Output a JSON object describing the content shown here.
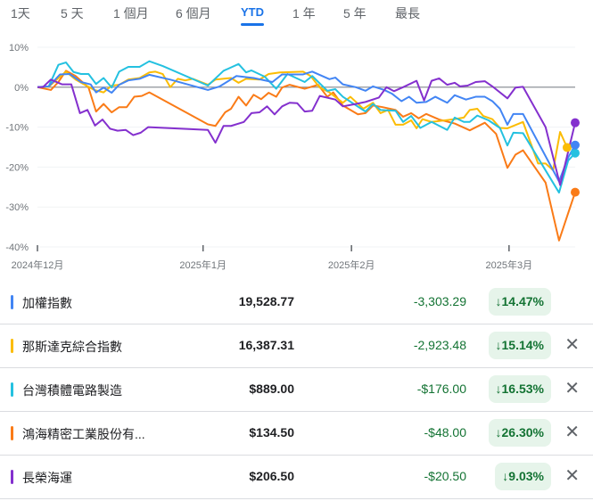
{
  "tabs": [
    {
      "label": "1天",
      "active": false
    },
    {
      "label": "5 天",
      "active": false
    },
    {
      "label": "1 個月",
      "active": false
    },
    {
      "label": "6 個月",
      "active": false
    },
    {
      "label": "YTD",
      "active": true
    },
    {
      "label": "1 年",
      "active": false
    },
    {
      "label": "5 年",
      "active": false
    },
    {
      "label": "最長",
      "active": false
    }
  ],
  "chart_data": {
    "type": "line",
    "title": "",
    "xlabel": "",
    "ylabel": "",
    "ylim": [
      -40,
      10
    ],
    "xlim": [
      0,
      100
    ],
    "yticks": [
      {
        "v": 10,
        "label": "10%"
      },
      {
        "v": 0,
        "label": "0%"
      },
      {
        "v": -10,
        "label": "-10%"
      },
      {
        "v": -20,
        "label": "-20%"
      },
      {
        "v": -30,
        "label": "-30%"
      },
      {
        "v": -40,
        "label": "-40%"
      }
    ],
    "xticks": [
      {
        "v": 0,
        "label": "2024年12月"
      },
      {
        "v": 30.8,
        "label": "2025年1月"
      },
      {
        "v": 58.4,
        "label": "2025年2月"
      },
      {
        "v": 87.7,
        "label": "2025年3月"
      }
    ],
    "series": [
      {
        "name": "加權指數",
        "color": "#4285f4",
        "points": [
          [
            0,
            0
          ],
          [
            2.1,
            0.2
          ],
          [
            4.2,
            3.2
          ],
          [
            6,
            3.3
          ],
          [
            8.1,
            1.3
          ],
          [
            9.9,
            0.7
          ],
          [
            10.9,
            -1.3
          ],
          [
            12.3,
            -0.1
          ],
          [
            13.8,
            -1.4
          ],
          [
            15.2,
            0.6
          ],
          [
            16.9,
            1.7
          ],
          [
            19,
            2.1
          ],
          [
            20.8,
            3.1
          ],
          [
            24.7,
            1.9
          ],
          [
            31.7,
            -0.7
          ],
          [
            33.9,
            0.2
          ],
          [
            37,
            2.8
          ],
          [
            40.2,
            2.3
          ],
          [
            43.7,
            1.3
          ],
          [
            45.5,
            3.2
          ],
          [
            49.4,
            3.2
          ],
          [
            51.1,
            3.9
          ],
          [
            54.3,
            2
          ],
          [
            55.4,
            2.4
          ],
          [
            56.8,
            0.7
          ],
          [
            59.2,
            0
          ],
          [
            61,
            -0.9
          ],
          [
            62.4,
            0.2
          ],
          [
            64.5,
            -0.7
          ],
          [
            65.9,
            -1.6
          ],
          [
            67.7,
            -3.5
          ],
          [
            69.1,
            -2.4
          ],
          [
            70.5,
            -3.9
          ],
          [
            72.3,
            -3.7
          ],
          [
            74,
            -2.4
          ],
          [
            76.2,
            -3.9
          ],
          [
            77.6,
            -2
          ],
          [
            79.7,
            -3.1
          ],
          [
            81.5,
            -2.4
          ],
          [
            83.2,
            -2.4
          ],
          [
            84.6,
            -3.5
          ],
          [
            86,
            -5.4
          ],
          [
            87.4,
            -9.4
          ],
          [
            88.5,
            -6.7
          ],
          [
            90.3,
            -6.7
          ],
          [
            97,
            -23.6
          ],
          [
            98.7,
            -17.6
          ],
          [
            100,
            -14.5
          ]
        ]
      },
      {
        "name": "那斯達克綜合指數",
        "color": "#fbbc04",
        "points": [
          [
            0,
            0
          ],
          [
            2.1,
            0.1
          ],
          [
            3.9,
            2.3
          ],
          [
            5.3,
            3.9
          ],
          [
            7.1,
            1.9
          ],
          [
            8.8,
            0.6
          ],
          [
            10.6,
            -0.7
          ],
          [
            12.3,
            -1.3
          ],
          [
            13.8,
            0.4
          ],
          [
            15.2,
            0.6
          ],
          [
            16.9,
            1.9
          ],
          [
            19,
            2.3
          ],
          [
            20.8,
            3.7
          ],
          [
            21.9,
            3.9
          ],
          [
            23.3,
            3.3
          ],
          [
            24.7,
            0
          ],
          [
            26.1,
            2.1
          ],
          [
            27.5,
            1.7
          ],
          [
            28.9,
            2.1
          ],
          [
            31.7,
            0.6
          ],
          [
            33.1,
            1.9
          ],
          [
            36,
            2.3
          ],
          [
            37.4,
            1.1
          ],
          [
            38.8,
            2.1
          ],
          [
            41.3,
            1.9
          ],
          [
            43,
            3.3
          ],
          [
            45.1,
            3.7
          ],
          [
            49.4,
            3.9
          ],
          [
            50.8,
            2.8
          ],
          [
            52.5,
            -0.1
          ],
          [
            54.3,
            -1.3
          ],
          [
            56.8,
            -3.9
          ],
          [
            58.2,
            -2.4
          ],
          [
            60.6,
            -5.4
          ],
          [
            62.4,
            -3.9
          ],
          [
            63.8,
            -6.5
          ],
          [
            65.2,
            -5.7
          ],
          [
            66.6,
            -9.4
          ],
          [
            68,
            -9.4
          ],
          [
            69.5,
            -8.3
          ],
          [
            70.5,
            -10.3
          ],
          [
            71.6,
            -8
          ],
          [
            73.3,
            -8.7
          ],
          [
            75.8,
            -8.3
          ],
          [
            77.6,
            -8
          ],
          [
            79.3,
            -7.6
          ],
          [
            80.4,
            -5.7
          ],
          [
            81.8,
            -5.4
          ],
          [
            82.9,
            -7.2
          ],
          [
            84.6,
            -8
          ],
          [
            86,
            -10.2
          ],
          [
            87.4,
            -10.3
          ],
          [
            90.3,
            -8.7
          ],
          [
            93.1,
            -19.1
          ],
          [
            94.5,
            -19.1
          ],
          [
            95.9,
            -20.8
          ],
          [
            97.2,
            -11.2
          ],
          [
            98.5,
            -15.1
          ]
        ]
      },
      {
        "name": "台灣積體電路製造",
        "color": "#24c1e0",
        "points": [
          [
            0,
            0
          ],
          [
            2.1,
            0.2
          ],
          [
            3.9,
            5.6
          ],
          [
            5.3,
            6.2
          ],
          [
            6.7,
            3.8
          ],
          [
            8.1,
            3.3
          ],
          [
            9.5,
            3.3
          ],
          [
            10.9,
            0.8
          ],
          [
            12.3,
            2.3
          ],
          [
            13.8,
            -0.1
          ],
          [
            15.2,
            3.9
          ],
          [
            16.9,
            5.1
          ],
          [
            19,
            5.1
          ],
          [
            20.8,
            6.5
          ],
          [
            23.3,
            5.3
          ],
          [
            31.7,
            0.4
          ],
          [
            34.6,
            4.1
          ],
          [
            37.4,
            5.8
          ],
          [
            38.8,
            3.7
          ],
          [
            39.8,
            4.2
          ],
          [
            42.3,
            2.6
          ],
          [
            44.4,
            -0.4
          ],
          [
            46.5,
            3.3
          ],
          [
            49.7,
            1.3
          ],
          [
            51.1,
            2.8
          ],
          [
            53.9,
            -0.9
          ],
          [
            55.4,
            -0.5
          ],
          [
            56.8,
            -2.4
          ],
          [
            61,
            -6.1
          ],
          [
            62.4,
            -4.2
          ],
          [
            63.8,
            -5.7
          ],
          [
            66.6,
            -5.9
          ],
          [
            68,
            -8.7
          ],
          [
            69.5,
            -7.2
          ],
          [
            71.2,
            -10.2
          ],
          [
            73.3,
            -8.7
          ],
          [
            76.2,
            -10.7
          ],
          [
            77.6,
            -7.6
          ],
          [
            79.3,
            -8.7
          ],
          [
            80.4,
            -8.7
          ],
          [
            81.8,
            -7.1
          ],
          [
            83.9,
            -8.3
          ],
          [
            86,
            -10.2
          ],
          [
            87.4,
            -14.6
          ],
          [
            88.5,
            -11.4
          ],
          [
            90.3,
            -11.5
          ],
          [
            97,
            -26.4
          ],
          [
            98.7,
            -18.4
          ],
          [
            100,
            -16.5
          ]
        ]
      },
      {
        "name": "鴻海精密工業股份有限公司",
        "color": "#fa7b17",
        "points": [
          [
            0,
            0
          ],
          [
            2.5,
            -0.7
          ],
          [
            3.9,
            1.3
          ],
          [
            5.3,
            4.1
          ],
          [
            7.1,
            2.8
          ],
          [
            9.5,
            -0.1
          ],
          [
            10.9,
            -6.1
          ],
          [
            12.3,
            -4.2
          ],
          [
            13.8,
            -6.3
          ],
          [
            15.2,
            -5
          ],
          [
            16.6,
            -5
          ],
          [
            18,
            -2.4
          ],
          [
            19.4,
            -2.2
          ],
          [
            20.8,
            -1.3
          ],
          [
            31.7,
            -9.3
          ],
          [
            33.1,
            -9.7
          ],
          [
            34.9,
            -6.3
          ],
          [
            36,
            -5.4
          ],
          [
            37.4,
            -2.4
          ],
          [
            38.8,
            -4.6
          ],
          [
            40.2,
            -1.9
          ],
          [
            41.6,
            -3
          ],
          [
            43,
            -1.4
          ],
          [
            44.4,
            -2.4
          ],
          [
            45.5,
            -0.1
          ],
          [
            46.9,
            0.6
          ],
          [
            49.7,
            -0.4
          ],
          [
            52.2,
            0.6
          ],
          [
            53.9,
            -2.4
          ],
          [
            55,
            -1.3
          ],
          [
            56.8,
            -4.6
          ],
          [
            59.6,
            -6.8
          ],
          [
            61,
            -6.5
          ],
          [
            62.4,
            -4.6
          ],
          [
            64.2,
            -5
          ],
          [
            66.6,
            -5.7
          ],
          [
            68,
            -7.4
          ],
          [
            69.5,
            -6.5
          ],
          [
            70.9,
            -7.8
          ],
          [
            72.3,
            -6.7
          ],
          [
            74.7,
            -8.1
          ],
          [
            77.6,
            -9.1
          ],
          [
            80.4,
            -10.8
          ],
          [
            83.2,
            -8.9
          ],
          [
            85.3,
            -11.7
          ],
          [
            87.4,
            -20.2
          ],
          [
            88.9,
            -16.9
          ],
          [
            90.3,
            -15.8
          ],
          [
            94.5,
            -23.9
          ],
          [
            97,
            -38.4
          ],
          [
            100,
            -26.3
          ]
        ]
      },
      {
        "name": "長榮海運",
        "color": "#8430ce",
        "points": [
          [
            0,
            0
          ],
          [
            1,
            0
          ],
          [
            2.5,
            1.9
          ],
          [
            4.6,
            0.7
          ],
          [
            6.3,
            0.7
          ],
          [
            7.9,
            -6.5
          ],
          [
            9.3,
            -5.7
          ],
          [
            10.7,
            -9.6
          ],
          [
            12.1,
            -8.1
          ],
          [
            13.5,
            -10.4
          ],
          [
            14.9,
            -10.9
          ],
          [
            16.4,
            -10.7
          ],
          [
            17.8,
            -12
          ],
          [
            19.2,
            -11.4
          ],
          [
            20.6,
            -10
          ],
          [
            31.7,
            -10.7
          ],
          [
            33.1,
            -13.9
          ],
          [
            34.6,
            -9.7
          ],
          [
            36,
            -9.7
          ],
          [
            38.4,
            -8.7
          ],
          [
            39.8,
            -6.5
          ],
          [
            41.3,
            -6.3
          ],
          [
            42.7,
            -4.8
          ],
          [
            44.1,
            -6.8
          ],
          [
            45.5,
            -4.8
          ],
          [
            46.9,
            -3.9
          ],
          [
            48.3,
            -4
          ],
          [
            49.7,
            -6.1
          ],
          [
            51.1,
            -5.9
          ],
          [
            52.5,
            -2.2
          ],
          [
            55.4,
            -3.1
          ],
          [
            56.8,
            -4.8
          ],
          [
            59.2,
            -4.2
          ],
          [
            61,
            -3.7
          ],
          [
            63.5,
            -2.6
          ],
          [
            64.9,
            0
          ],
          [
            66.3,
            -1
          ],
          [
            68,
            0
          ],
          [
            70.5,
            1.6
          ],
          [
            71.9,
            -3.3
          ],
          [
            73.3,
            1.6
          ],
          [
            74.7,
            2.2
          ],
          [
            76.2,
            0.6
          ],
          [
            77.6,
            1.1
          ],
          [
            78.6,
            0.2
          ],
          [
            80,
            0.4
          ],
          [
            81.5,
            1.3
          ],
          [
            83.2,
            1.5
          ],
          [
            84.6,
            0.2
          ],
          [
            87.4,
            -2.8
          ],
          [
            88.9,
            -0.1
          ],
          [
            90.3,
            0.1
          ],
          [
            94.5,
            -10
          ],
          [
            97.2,
            -24.5
          ],
          [
            100,
            -8.9
          ]
        ]
      }
    ]
  },
  "rows": [
    {
      "name": "加權指數",
      "color": "#4285f4",
      "price": "19,528.77",
      "change": "-3,303.29",
      "percent": "↓14.47%",
      "removable": false
    },
    {
      "name": "那斯達克綜合指數",
      "color": "#fbbc04",
      "price": "16,387.31",
      "change": "-2,923.48",
      "percent": "↓15.14%",
      "removable": true
    },
    {
      "name": "台灣積體電路製造",
      "color": "#24c1e0",
      "price": "$889.00",
      "change": "-$176.00",
      "percent": "↓16.53%",
      "removable": true
    },
    {
      "name": "鴻海精密工業股份有...",
      "color": "#fa7b17",
      "price": "$134.50",
      "change": "-$48.00",
      "percent": "↓26.30%",
      "removable": true
    },
    {
      "name": "長榮海運",
      "color": "#8430ce",
      "price": "$206.50",
      "change": "-$20.50",
      "percent": "↓9.03%",
      "removable": true
    }
  ],
  "icons": {
    "remove": "close-icon",
    "close_glyph": "✕"
  }
}
